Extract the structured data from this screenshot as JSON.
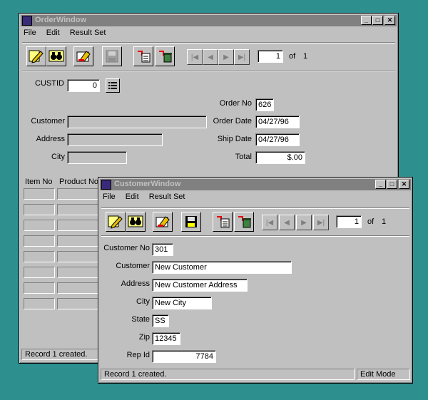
{
  "order_window": {
    "title": "OrderWindow",
    "menu": [
      "File",
      "Edit",
      "Result Set"
    ],
    "page_current": "1",
    "page_of": "of",
    "page_total": "1",
    "custid_label": "CUSTID",
    "custid_value": "0",
    "order_no_label": "Order No",
    "order_no_value": "626",
    "customer_label": "Customer",
    "order_date_label": "Order Date",
    "order_date_value": "04/27/96",
    "address_label": "Address",
    "ship_date_label": "Ship Date",
    "ship_date_value": "04/27/96",
    "city_label": "City",
    "total_label": "Total",
    "total_value": "$.00",
    "grid_headers": [
      "Item No",
      "Product No"
    ],
    "status": "Record 1 created."
  },
  "customer_window": {
    "title": "CustomerWindow",
    "menu": [
      "File",
      "Edit",
      "Result Set"
    ],
    "page_current": "1",
    "page_of": "of",
    "page_total": "1",
    "fields": {
      "customer_no_label": "Customer No",
      "customer_no_value": "301",
      "customer_label": "Customer",
      "customer_value": "New Customer",
      "address_label": "Address",
      "address_value": "New Customer Address",
      "city_label": "City",
      "city_value": "New City",
      "state_label": "State",
      "state_value": "SS",
      "zip_label": "Zip",
      "zip_value": "12345",
      "rep_id_label": "Rep Id",
      "rep_id_value": "7784"
    },
    "status": "Record 1 created.",
    "mode": "Edit Mode"
  },
  "icons": {
    "toolbar": [
      "edit-pencil-icon",
      "binoculars-icon",
      "eraser-icon",
      "save-disk-icon",
      "insert-record-icon",
      "delete-record-icon"
    ],
    "nav": [
      "first-record-icon",
      "prev-record-icon",
      "next-record-icon",
      "last-record-icon"
    ]
  },
  "colors": {
    "desktop": "#2e8f8f",
    "window": "#c0c0c0",
    "titlebar_inactive": "#808080"
  }
}
